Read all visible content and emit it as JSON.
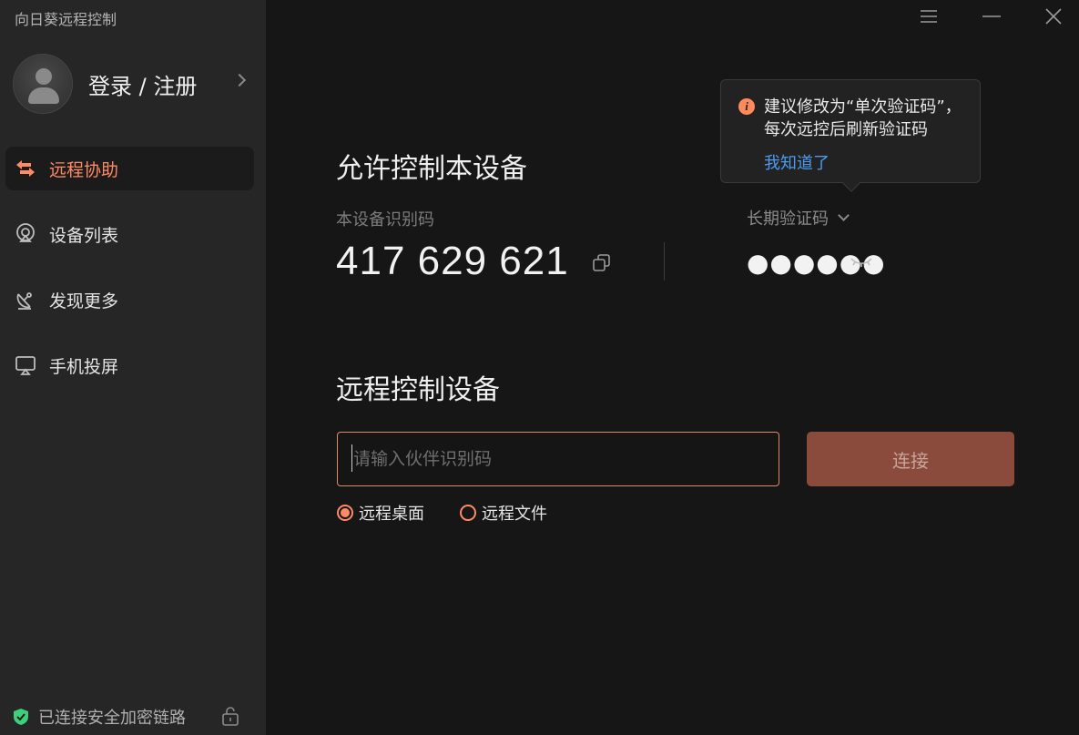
{
  "app": {
    "title": "向日葵远程控制"
  },
  "account": {
    "login_label": "登录 / 注册"
  },
  "sidebar": {
    "items": [
      {
        "label": "远程协助",
        "icon": "remote-assist-icon",
        "active": true
      },
      {
        "label": "设备列表",
        "icon": "device-list-icon",
        "active": false
      },
      {
        "label": "发现更多",
        "icon": "satellite-dish-icon",
        "active": false
      },
      {
        "label": "手机投屏",
        "icon": "screen-cast-icon",
        "active": false
      }
    ],
    "footer_status": "已连接安全加密链路"
  },
  "allow_control": {
    "title": "允许控制本设备",
    "device_id_label": "本设备识别码",
    "device_id": "417 629 621",
    "password_type_label": "长期验证码",
    "password_masked": "●●●●●●"
  },
  "tooltip": {
    "message": "建议修改为“单次验证码”，每次远控后刷新验证码",
    "ok_label": "我知道了"
  },
  "remote_control": {
    "title": "远程控制设备",
    "input_placeholder": "请输入伙伴识别码",
    "connect_label": "连接",
    "modes": [
      {
        "label": "远程桌面",
        "checked": true
      },
      {
        "label": "远程文件",
        "checked": false
      }
    ]
  },
  "colors": {
    "accent": "#ff8a66",
    "connect_button": "#8a4b3c",
    "link": "#4b9cf0",
    "secure": "#3ecf7a"
  }
}
